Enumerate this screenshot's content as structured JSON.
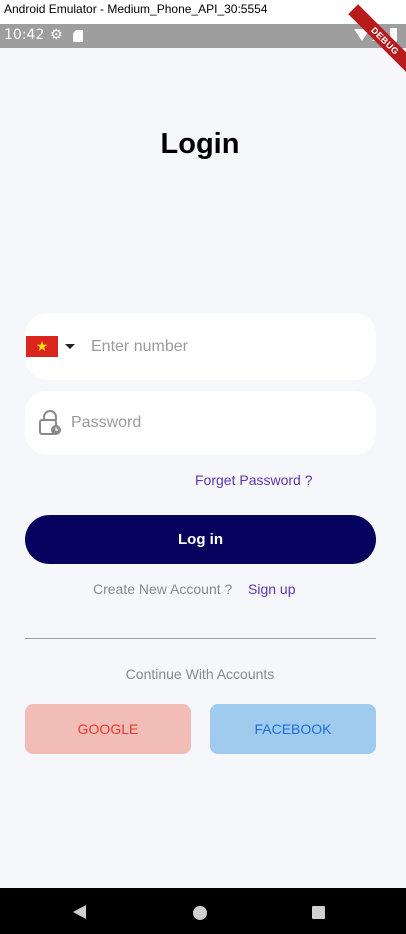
{
  "window": {
    "title": "Android Emulator - Medium_Phone_API_30:5554"
  },
  "status_bar": {
    "time": "10:42",
    "icons": [
      "gear-icon",
      "sd-card-icon",
      "wifi-icon",
      "signal-icon",
      "battery-icon"
    ]
  },
  "debug_banner": "DEBUG",
  "login": {
    "title": "Login",
    "phone": {
      "country": "vn-flag-icon",
      "placeholder": "Enter number",
      "value": ""
    },
    "password": {
      "placeholder": "Password",
      "value": ""
    },
    "forget_password": "Forget Password ?",
    "login_button": "Log in",
    "create_account_text": "Create New Account ?",
    "sign_up": "Sign up",
    "continue_text": "Continue With Accounts",
    "google_button": "GOOGLE",
    "facebook_button": "FACEBOOK"
  },
  "colors": {
    "primary": "#05035e",
    "link": "#5e35b1",
    "google_bg": "#f2bcb7",
    "google_text": "#e53935",
    "facebook_bg": "#9ecbee",
    "facebook_text": "#1e6fd9",
    "background": "#f5f7fa"
  },
  "nav_bar": {
    "icons": [
      "back-icon",
      "home-icon",
      "recents-icon"
    ]
  }
}
